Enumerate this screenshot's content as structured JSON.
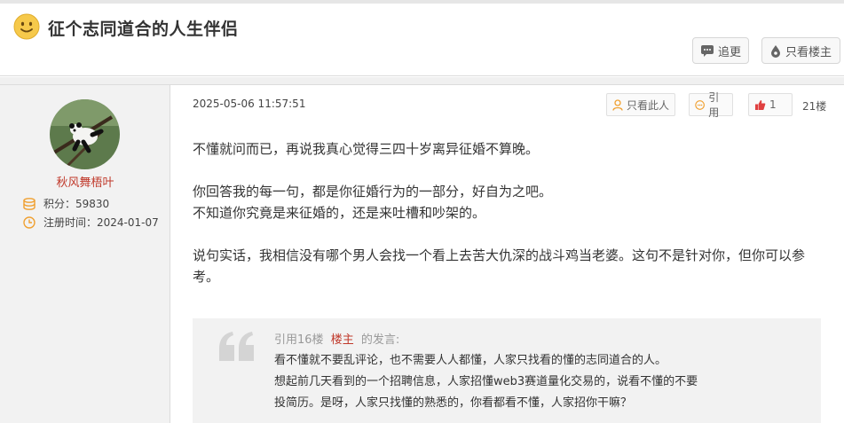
{
  "header": {
    "title": "征个志同道合的人生伴侣",
    "follow_label": "追更",
    "only_owner_label": "只看楼主"
  },
  "post": {
    "author": {
      "name": "秋风舞梧叶",
      "points": "积分：59830",
      "registered": "注册时间：2024-01-07"
    },
    "timestamp": "2025-05-06 11:57:51",
    "actions": {
      "only_this_label": "只看此人",
      "quote_label": "引用",
      "like_count": "1"
    },
    "floor": "21楼",
    "paragraphs": [
      "不懂就问而已，再说我真心觉得三四十岁离异征婚不算晚。",
      "",
      "你回答我的每一句，都是你征婚行为的一部分，好自为之吧。",
      "不知道你究竟是来征婚的，还是来吐槽和吵架的。",
      "",
      "说句实话，我相信没有哪个男人会找一个看上去苦大仇深的战斗鸡当老婆。这句不是针对你，但你可以参考。"
    ],
    "quote": {
      "prefix": "引用16楼",
      "owner": "楼主",
      "suffix": "的发言:",
      "lines": [
        "看不懂就不要乱评论，也不需要人人都懂，人家只找看的懂的志同道合的人。",
        "想起前几天看到的一个招聘信息，人家招懂web3赛道量化交易的，说看不懂的不要",
        "投简历。是呀，人家只找懂的熟悉的，你看都看不懂，人家招你干嘛？"
      ]
    }
  },
  "colors": {
    "username": "#c0392b",
    "icon_orange": "#f0a030",
    "like_red": "#e04040"
  }
}
